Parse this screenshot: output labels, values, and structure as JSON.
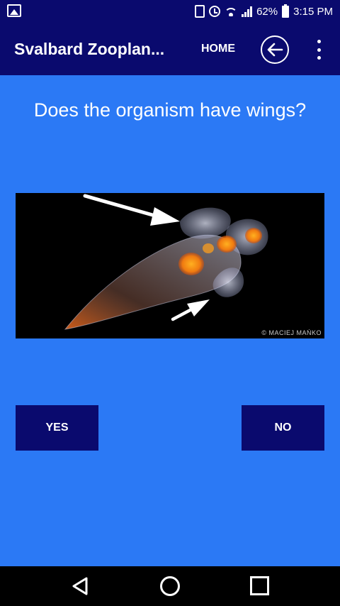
{
  "status_bar": {
    "battery": "62%",
    "time": "3:15 PM",
    "icons": [
      "gallery-icon",
      "vibrate-icon",
      "alarm-icon",
      "wifi-icon",
      "signal-icon",
      "battery-icon"
    ]
  },
  "app_bar": {
    "title": "Svalbard Zooplan...",
    "home_label": "HOME",
    "back_icon": "arrow-left-icon",
    "menu_icon": "more-vert-icon"
  },
  "question": {
    "text": "Does the organism have wings?"
  },
  "specimen_image": {
    "credit": "© MACIEJ MAŃKO"
  },
  "answers": {
    "yes_label": "YES",
    "no_label": "NO"
  },
  "nav_bar": {
    "icons": [
      "nav-back-icon",
      "nav-home-icon",
      "nav-recent-icon"
    ]
  },
  "colors": {
    "background": "#2b79f5",
    "bar": "#0a0a6e",
    "button": "#0a0a6e"
  }
}
